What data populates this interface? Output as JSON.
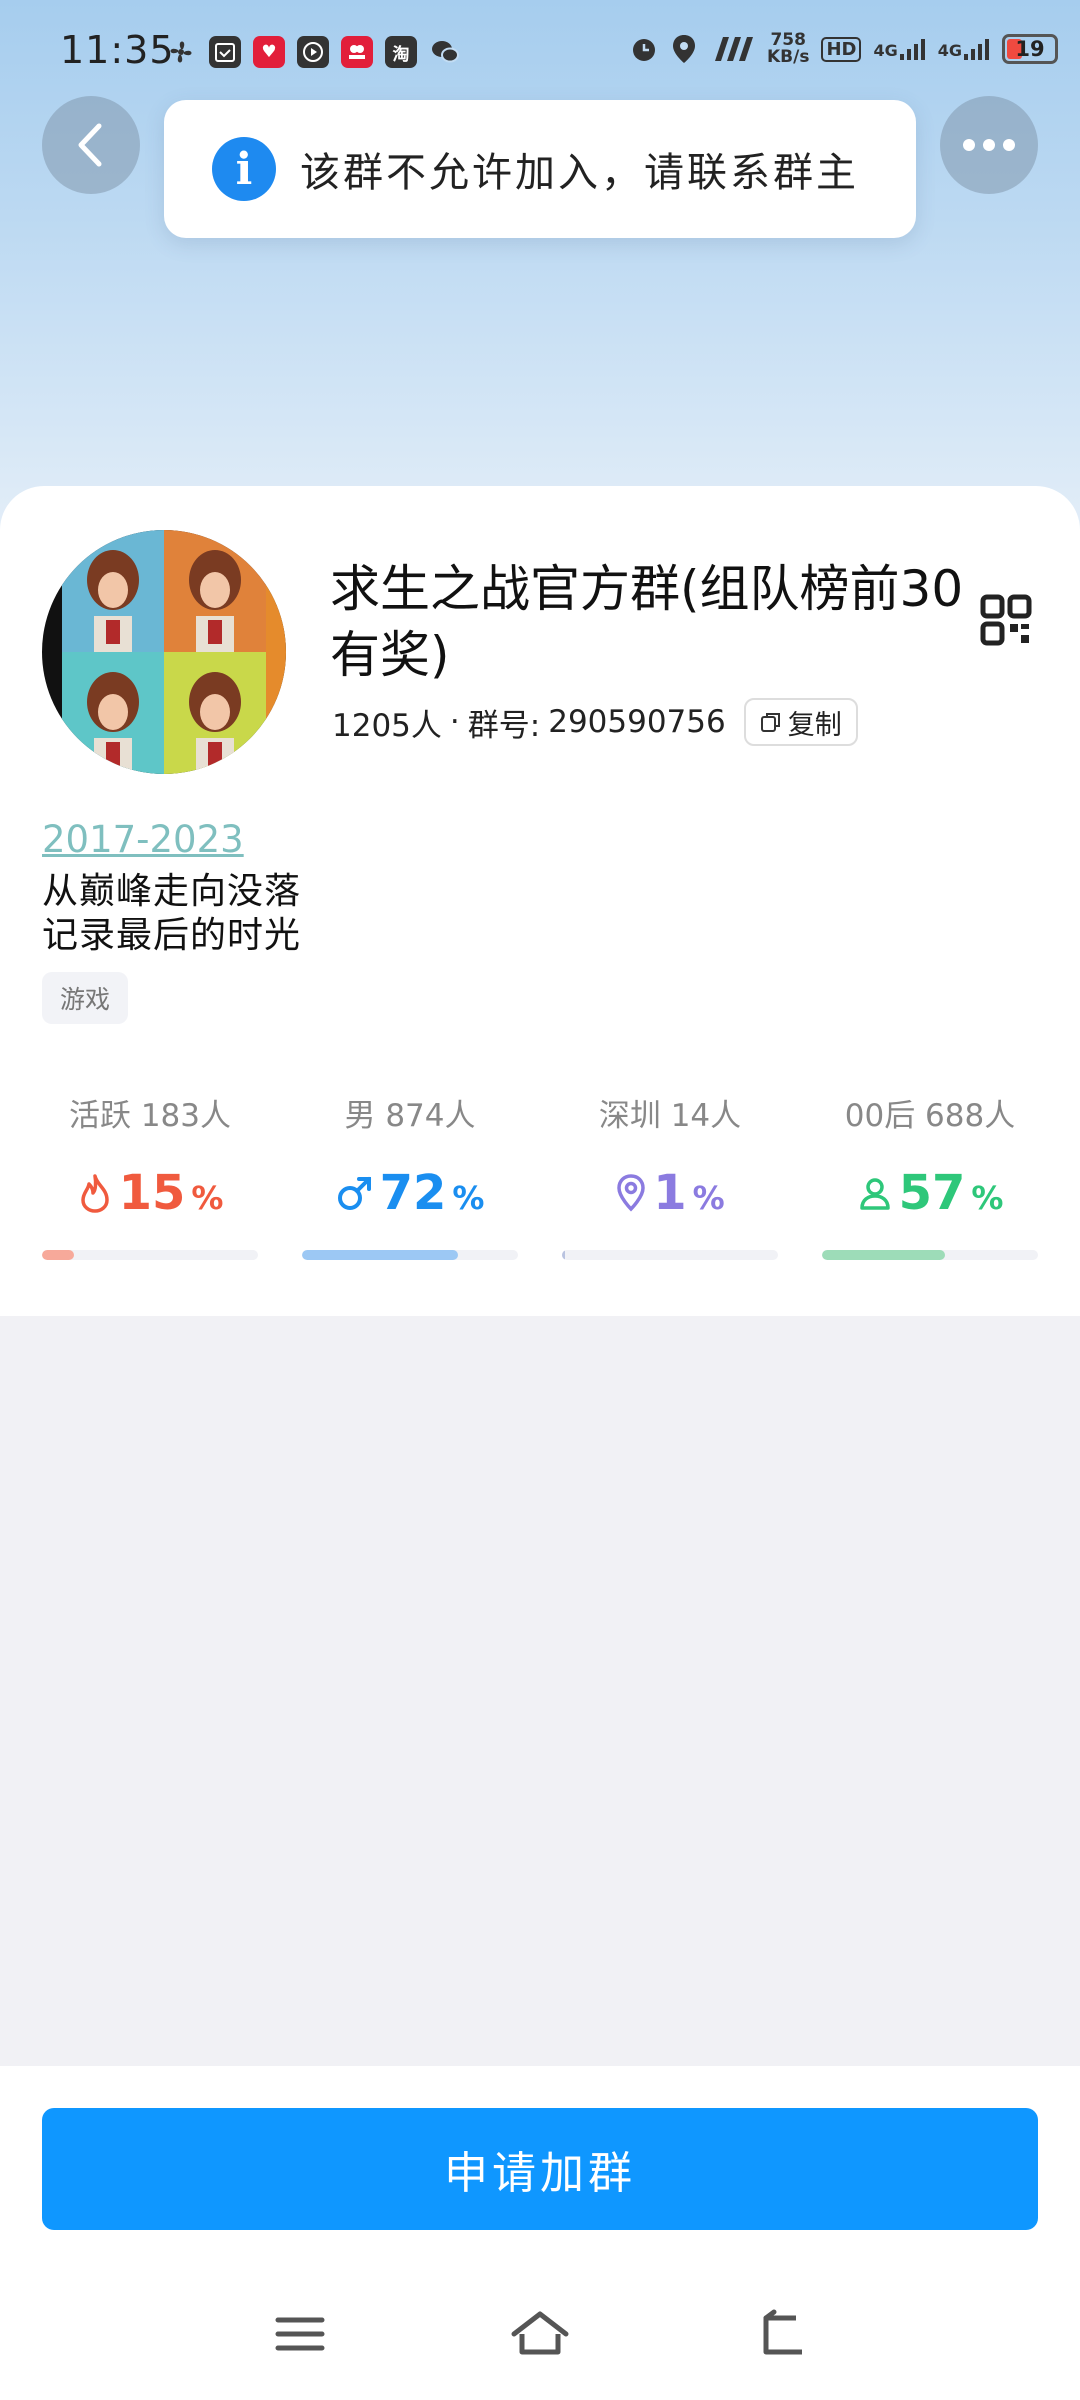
{
  "status_bar": {
    "time": "11:35",
    "app_icons": [
      "fan-icon",
      "calendar-icon",
      "heart-app-icon",
      "play-icon",
      "shop-app-icon",
      "taobao-icon",
      "wechat-icon"
    ],
    "taobao_char": "淘",
    "speed_value": "758",
    "speed_unit": "KB/s",
    "hd_label": "HD",
    "net1": "4G",
    "net2": "4G",
    "battery": "19",
    "battery_color": "#f04a40"
  },
  "toast": {
    "icon_glyph": "i",
    "message": "该群不允许加入，请联系群主"
  },
  "group": {
    "name": "求生之战官方群(组队榜前30有奖)",
    "members": "1205人",
    "separator": "·",
    "id_label": "群号:",
    "id": "290590756",
    "copy_label": "复制"
  },
  "description": {
    "link": "2017-2023",
    "lines": [
      "从巅峰走向没落",
      "记录最后的时光"
    ]
  },
  "tags": [
    "游戏"
  ],
  "stats": [
    {
      "label": "活跃 183人",
      "value": "15",
      "unit": "%",
      "color": "#f05a3e",
      "bar_color": "#f7a99a",
      "icon": "flame-icon",
      "fraction": 0.15
    },
    {
      "label": "男 874人",
      "value": "72",
      "unit": "%",
      "color": "#1a8ef0",
      "bar_color": "#9cc8f4",
      "icon": "male-icon",
      "fraction": 0.72
    },
    {
      "label": "深圳 14人",
      "value": "1",
      "unit": "%",
      "color": "#8b7be0",
      "bar_color": "#b9c3e0",
      "icon": "location-pin-icon",
      "fraction": 0.01
    },
    {
      "label": "00后 688人",
      "value": "57",
      "unit": "%",
      "color": "#2ec77a",
      "bar_color": "#9ddcb8",
      "icon": "person-icon",
      "fraction": 0.57
    }
  ],
  "actions": {
    "apply_label": "申请加群"
  },
  "colors": {
    "accent": "#0f97ff",
    "toast_icon": "#1e8af0"
  }
}
